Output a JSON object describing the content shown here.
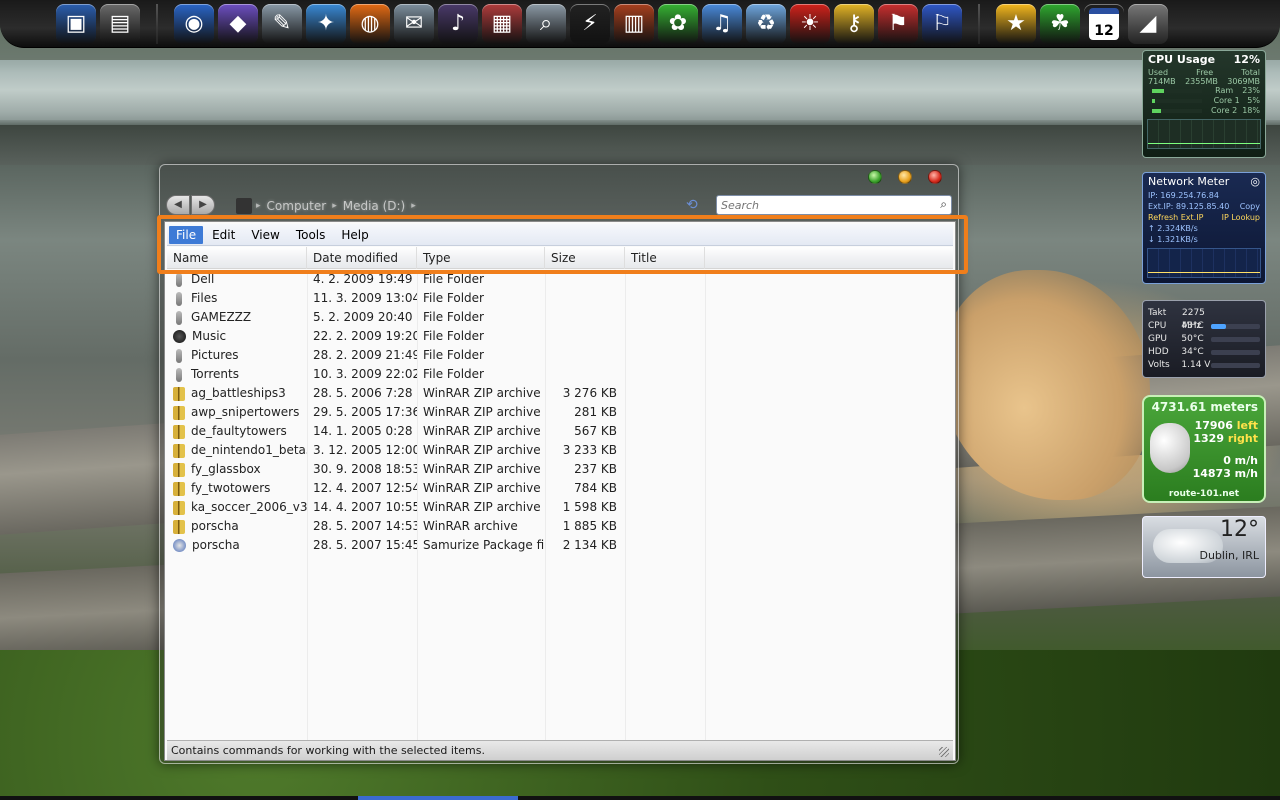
{
  "dock": {
    "left_icons": [
      {
        "name": "desktop-icon",
        "glyph": "▣",
        "color": "#2b5fb0"
      },
      {
        "name": "document-icon",
        "glyph": "▤",
        "color": "#6a6a6a"
      }
    ],
    "middle_icons": [
      {
        "name": "google-earth-icon",
        "glyph": "◉",
        "color": "#2a66c9"
      },
      {
        "name": "binary-icon",
        "glyph": "◆",
        "color": "#6d4fc2"
      },
      {
        "name": "pencil-icon",
        "glyph": "✎",
        "color": "#8a9aa8"
      },
      {
        "name": "safari-icon",
        "glyph": "✦",
        "color": "#3a8ad6"
      },
      {
        "name": "firefox-icon",
        "glyph": "◍",
        "color": "#e46b14"
      },
      {
        "name": "mail-icon",
        "glyph": "✉",
        "color": "#7d8f9e"
      },
      {
        "name": "media-icon",
        "glyph": "♪",
        "color": "#4a3a6a"
      },
      {
        "name": "winrar-icon",
        "glyph": "▦",
        "color": "#b03c3c"
      },
      {
        "name": "magnifier-icon",
        "glyph": "⌕",
        "color": "#8c9aa6"
      },
      {
        "name": "winamp-icon",
        "glyph": "⚡",
        "color": "#222222"
      },
      {
        "name": "dictionary-icon",
        "glyph": "▥",
        "color": "#a8401e"
      },
      {
        "name": "icq-icon",
        "glyph": "✿",
        "color": "#36b233"
      },
      {
        "name": "itunes-icon",
        "glyph": "♫",
        "color": "#4a8bdc"
      },
      {
        "name": "recycle-icon",
        "glyph": "♻",
        "color": "#6fa7e0"
      },
      {
        "name": "nero-icon",
        "glyph": "☀",
        "color": "#d1221b"
      },
      {
        "name": "key-icon",
        "glyph": "⚷",
        "color": "#e4b526"
      },
      {
        "name": "flags-icon",
        "glyph": "⚑",
        "color": "#c92f2f"
      },
      {
        "name": "flags2-icon",
        "glyph": "⚐",
        "color": "#2f58c9"
      }
    ],
    "right_icons": [
      {
        "name": "star-icon",
        "glyph": "★",
        "color": "#f4b81e"
      },
      {
        "name": "gecko-icon",
        "glyph": "☘",
        "color": "#2fa82f"
      }
    ],
    "calendar_day": "12"
  },
  "window": {
    "nav": {
      "back_label": "◀",
      "forward_label": "▶",
      "breadcrumb": [
        "Computer",
        "Media (D:)"
      ],
      "search_placeholder": "Search"
    },
    "menu": {
      "items": [
        {
          "label": "File",
          "active": true
        },
        {
          "label": "Edit",
          "active": false
        },
        {
          "label": "View",
          "active": false
        },
        {
          "label": "Tools",
          "active": false
        },
        {
          "label": "Help",
          "active": false
        }
      ]
    },
    "columns": {
      "name": "Name",
      "date": "Date modified",
      "type": "Type",
      "size": "Size",
      "title": "Title"
    },
    "files": [
      {
        "name": "Dell",
        "date": "4. 2. 2009 19:49",
        "type": "File Folder",
        "size": "",
        "icon": "folder"
      },
      {
        "name": "Files",
        "date": "11. 3. 2009 13:04",
        "type": "File Folder",
        "size": "",
        "icon": "folder"
      },
      {
        "name": "GAMEZZZ",
        "date": "5. 2. 2009 20:40",
        "type": "File Folder",
        "size": "",
        "icon": "folder"
      },
      {
        "name": "Music",
        "date": "22. 2. 2009 19:20",
        "type": "File Folder",
        "size": "",
        "icon": "music"
      },
      {
        "name": "Pictures",
        "date": "28. 2. 2009 21:49",
        "type": "File Folder",
        "size": "",
        "icon": "folder"
      },
      {
        "name": "Torrents",
        "date": "10. 3. 2009 22:02",
        "type": "File Folder",
        "size": "",
        "icon": "folder"
      },
      {
        "name": "ag_battleships3",
        "date": "28. 5. 2006 7:28",
        "type": "WinRAR ZIP archive",
        "size": "3 276 KB",
        "icon": "zip"
      },
      {
        "name": "awp_snipertowers",
        "date": "29. 5. 2005 17:36",
        "type": "WinRAR ZIP archive",
        "size": "281 KB",
        "icon": "zip"
      },
      {
        "name": "de_faultytowers",
        "date": "14. 1. 2005 0:28",
        "type": "WinRAR ZIP archive",
        "size": "567 KB",
        "icon": "zip"
      },
      {
        "name": "de_nintendo1_beta5",
        "date": "3. 12. 2005 12:00",
        "type": "WinRAR ZIP archive",
        "size": "3 233 KB",
        "icon": "zip"
      },
      {
        "name": "fy_glassbox",
        "date": "30. 9. 2008 18:53",
        "type": "WinRAR ZIP archive",
        "size": "237 KB",
        "icon": "zip"
      },
      {
        "name": "fy_twotowers",
        "date": "12. 4. 2007 12:54",
        "type": "WinRAR ZIP archive",
        "size": "784 KB",
        "icon": "zip"
      },
      {
        "name": "ka_soccer_2006_v3",
        "date": "14. 4. 2007 10:55",
        "type": "WinRAR ZIP archive",
        "size": "1 598 KB",
        "icon": "zip"
      },
      {
        "name": "porscha",
        "date": "28. 5. 2007 14:53",
        "type": "WinRAR archive",
        "size": "1 885 KB",
        "icon": "zip"
      },
      {
        "name": "porscha",
        "date": "28. 5. 2007 15:45",
        "type": "Samurize Package file",
        "size": "2 134 KB",
        "icon": "pkg"
      }
    ],
    "status": "Contains commands for working with the selected items."
  },
  "gadgets": {
    "cpu": {
      "title": "CPU Usage",
      "percent": "12%",
      "hdr_used": "Used",
      "hdr_free": "Free",
      "hdr_total": "Total",
      "used": "714MB",
      "free": "2355MB",
      "total": "3069MB",
      "ram_label": "Ram",
      "ram_pct": "23%",
      "core1_label": "Core 1",
      "core1_pct": "5%",
      "core2_label": "Core 2",
      "core2_pct": "18%",
      "ram_level": 0.23,
      "core1_level": 0.05,
      "core2_level": 0.18
    },
    "network": {
      "title": "Network Meter",
      "ip": "IP: 169.254.76.84",
      "ext_ip": "Ext.IP: 89.125.85.40",
      "copy": "Copy",
      "refresh": "Refresh Ext.IP",
      "lookup": "IP Lookup",
      "up": "2.324KB/s",
      "down": "1.321KB/s"
    },
    "temps": {
      "rows": [
        {
          "k": "Takt",
          "v": "2275 MHz",
          "level": 0
        },
        {
          "k": "CPU",
          "v": "43°C",
          "level": 0.3
        },
        {
          "k": "GPU",
          "v": "50°C",
          "level": 0
        },
        {
          "k": "HDD",
          "v": "34°C",
          "level": 0
        },
        {
          "k": "Volts",
          "v": "1.14 V",
          "level": 0
        }
      ]
    },
    "mouse": {
      "meters": "4731.61 meters",
      "left_val": "17906",
      "left_word": "left",
      "right_val": "1329",
      "right_word": "right",
      "speed": "0 m/h",
      "max_speed": "14873 m/h",
      "site": "route-101.net"
    },
    "weather": {
      "temp": "12°",
      "city": "Dublin, IRL"
    }
  }
}
